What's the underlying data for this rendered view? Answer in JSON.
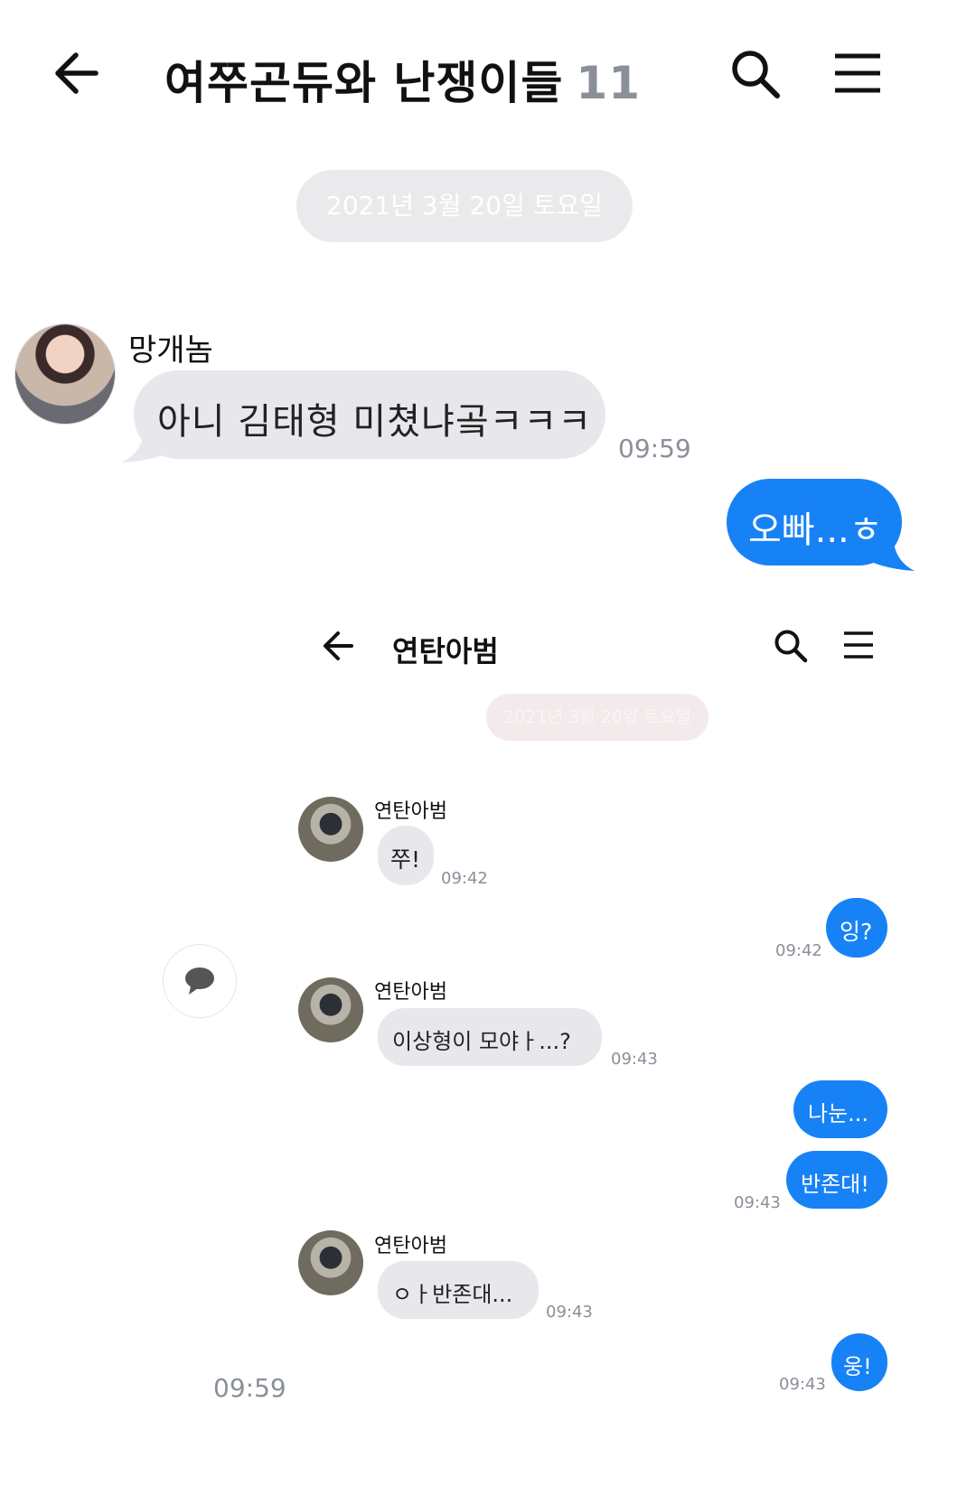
{
  "header": {
    "back_icon": "arrow-left-icon",
    "title": "여쭈곤듀와 난쟁이들",
    "member_count": "11",
    "search_icon": "search-icon",
    "menu_icon": "hamburger-menu-icon"
  },
  "date_divider": "2021년 3월 20일 토요일",
  "messages": [
    {
      "sender": "망개놈",
      "text": "아니 김태형 미쳤냐곸ㅋㅋㅋ",
      "time": "09:59"
    },
    {
      "text": "오빠...ㅎ"
    }
  ],
  "embedded": {
    "header": {
      "title": "연탄아범"
    },
    "date_divider": "2021년 3월 20일 토요일",
    "messages": [
      {
        "sender": "연탄아범",
        "text": "쭈!",
        "time": "09:42"
      },
      {
        "text": "잉?",
        "time": "09:42"
      },
      {
        "sender": "연탄아범",
        "text": "이상형이 모야ㅏ...?",
        "time": "09:43"
      },
      {
        "text": "나눈..."
      },
      {
        "text": "반존대!",
        "time": "09:43"
      },
      {
        "sender": "연탄아범",
        "text": "ㅇㅏ반존대...",
        "time": "09:43"
      },
      {
        "text": "웅!",
        "time": "09:43"
      }
    ]
  },
  "bottom_time": "09:59",
  "floating_icon": "chat-bubble-icon",
  "colors": {
    "accent": "#1782f5",
    "incoming_bubble": "#e8e8ec",
    "muted": "#8a8f99"
  }
}
